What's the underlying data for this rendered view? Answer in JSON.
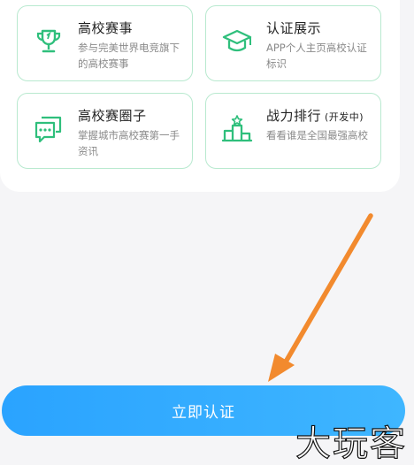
{
  "features": [
    {
      "title": "高校赛事",
      "tag": "",
      "desc": "参与完美世界电竞旗下的高校赛事",
      "icon": "trophy-icon"
    },
    {
      "title": "认证展示",
      "tag": "",
      "desc": "APP个人主页高校认证标识",
      "icon": "graduation-cap-icon"
    },
    {
      "title": "高校赛圈子",
      "tag": "",
      "desc": "掌握城市高校赛第一手资讯",
      "icon": "chat-bubble-icon"
    },
    {
      "title": "战力排行",
      "tag": "(开发中)",
      "desc": "看看谁是全国最强高校",
      "icon": "podium-icon"
    }
  ],
  "cta": {
    "label": "立即认证"
  },
  "watermark": {
    "text": "大玩客"
  },
  "colors": {
    "accent_green": "#2fbf7c",
    "card_border": "#b8e9cf",
    "button_blue": "#2aa3ff",
    "arrow_orange": "#f28a2e"
  }
}
